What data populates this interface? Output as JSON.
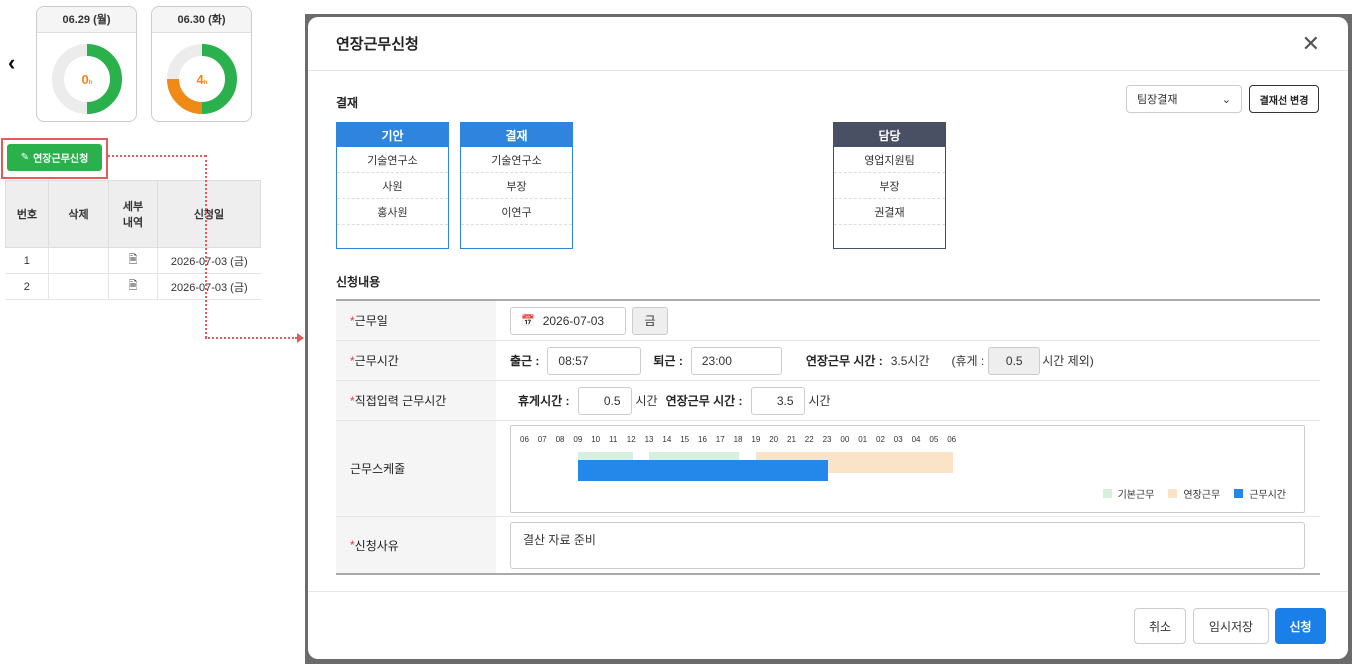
{
  "calendar": {
    "days": [
      {
        "date": "06.29 (월)",
        "hours": "0",
        "unit": "h",
        "progress": 0.5,
        "overtime": 0
      },
      {
        "date": "06.30 (화)",
        "hours": "4",
        "unit": "h",
        "progress": 0.5,
        "overtime": 0.25
      }
    ],
    "back_icon": "chevron-left-icon"
  },
  "apply_button": {
    "label": "연장근무신청",
    "icon": "pencil-icon"
  },
  "history": {
    "columns": [
      "번호",
      "삭제",
      "세부\n내역",
      "신청일"
    ],
    "rows": [
      {
        "no": "1",
        "date": "2026-07-03 (금)"
      },
      {
        "no": "2",
        "date": "2026-07-03 (금)"
      }
    ]
  },
  "modal": {
    "title": "연장근무신청",
    "approval_label": "결재",
    "approval_line": {
      "selected": "팀장결재",
      "change_button": "결재선 변경"
    },
    "approvers": [
      {
        "role": "기안",
        "dept": "기술연구소",
        "position": "사원",
        "name": "홍사원"
      },
      {
        "role": "결재",
        "dept": "기술연구소",
        "position": "부장",
        "name": "이연구"
      },
      {
        "role": "담당",
        "dept": "영업지원팀",
        "position": "부장",
        "name": "권결재"
      }
    ],
    "content_label": "신청내용",
    "fields": {
      "work_date": {
        "label": "근무일",
        "value": "2026-07-03",
        "weekday": "금"
      },
      "work_time": {
        "label": "근무시간",
        "in_label": "출근 :",
        "in_value": "08:57",
        "out_label": "퇴근 :",
        "out_value": "23:00",
        "ot_label": "연장근무 시간 :",
        "ot_value": "3.5시간",
        "break_prefix": "(휴게 :",
        "break_value": "0.5",
        "break_suffix": "시간 제외)"
      },
      "manual": {
        "label": "직접입력 근무시간",
        "break_label": "휴게시간 :",
        "break_value": "0.5",
        "unit": "시간",
        "ot_label": "연장근무 시간 :",
        "ot_value": "3.5"
      },
      "schedule": {
        "label": "근무스케줄",
        "hours": [
          "06",
          "07",
          "08",
          "09",
          "10",
          "11",
          "12",
          "13",
          "14",
          "15",
          "16",
          "17",
          "18",
          "19",
          "20",
          "21",
          "22",
          "23",
          "00",
          "01",
          "02",
          "03",
          "04",
          "05",
          "06"
        ],
        "legend": [
          "기본근무",
          "연장근무",
          "근무시간"
        ],
        "colors": {
          "base": "#d6efdf",
          "overtime": "#fbe3c8",
          "work": "#2388ea"
        }
      },
      "reason": {
        "label": "신청사유",
        "value": "결산 자료 준비"
      }
    },
    "buttons": {
      "cancel": "취소",
      "save": "임시저장",
      "submit": "신청"
    }
  }
}
